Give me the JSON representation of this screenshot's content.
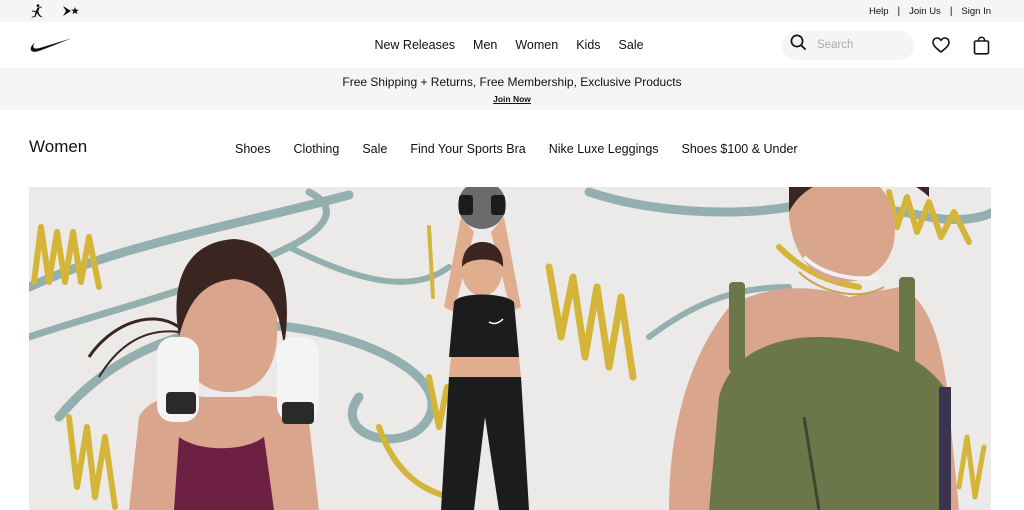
{
  "utility_bar": {
    "brand_icons": [
      "jumpman-icon",
      "converse-icon"
    ],
    "links": [
      "Help",
      "Join Us",
      "Sign In"
    ],
    "separator": "|"
  },
  "header": {
    "logo": "swoosh-logo",
    "nav": [
      "New Releases",
      "Men",
      "Women",
      "Kids",
      "Sale"
    ],
    "search": {
      "placeholder": "Search",
      "value": ""
    },
    "icons": [
      "search-icon",
      "heart-icon",
      "bag-icon"
    ]
  },
  "promo": {
    "text": "Free Shipping + Returns, Free Membership, Exclusive Products",
    "link": "Join Now"
  },
  "category": {
    "title": "Women",
    "nav": [
      "Shoes",
      "Clothing",
      "Sale",
      "Find Your Sports Bra",
      "Nike Luxe Leggings",
      "Shoes $100 & Under"
    ]
  },
  "hero": {
    "description_icon": "hero-image",
    "colors": {
      "background": "#ece9e9",
      "teal_stroke": "#8aa9a8",
      "yellow_stroke": "#d4b53a",
      "maroon": "#6e1f44",
      "olive": "#6b7748",
      "black": "#1c1c1c"
    }
  }
}
